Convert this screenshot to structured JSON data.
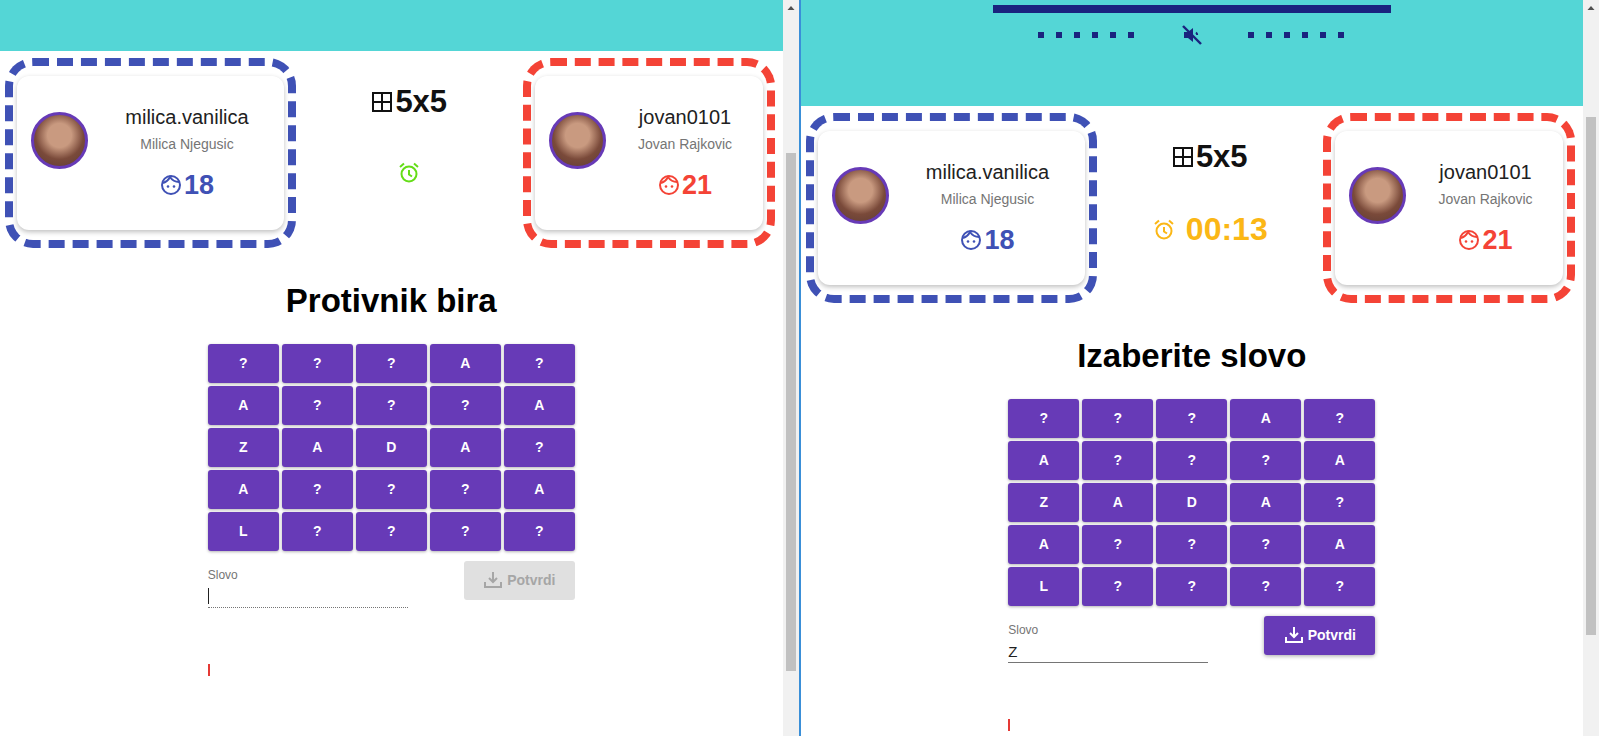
{
  "windows": [
    {
      "header": {
        "kind": "plain"
      },
      "players": [
        {
          "username": "milica.vanilica",
          "full_name": "Milica Njegusic",
          "score": "18",
          "color": "#3f51b5"
        },
        {
          "username": "jovan0101",
          "full_name": "Jovan Rajkovic",
          "score": "21",
          "color": "#f44336"
        }
      ],
      "board_size": "5x5",
      "timer": {
        "text": "",
        "color": "#64dd17"
      },
      "status": "Protivnik bira",
      "grid": [
        [
          "?",
          "?",
          "?",
          "A",
          "?"
        ],
        [
          "A",
          "?",
          "?",
          "?",
          "A"
        ],
        [
          "Z",
          "A",
          "D",
          "A",
          "?"
        ],
        [
          "A",
          "?",
          "?",
          "?",
          "A"
        ],
        [
          "L",
          "?",
          "?",
          "?",
          "?"
        ]
      ],
      "input": {
        "label": "Slovo",
        "value": "",
        "disabled": true,
        "focused": true
      },
      "confirm_button": {
        "label": "Potvrdi",
        "disabled": true
      },
      "scrollbar": {
        "thumb_start": 0.19,
        "thumb_size": 0.72
      }
    },
    {
      "header": {
        "kind": "controls",
        "muted": true,
        "level": 1
      },
      "players": [
        {
          "username": "milica.vanilica",
          "full_name": "Milica Njegusic",
          "score": "18",
          "color": "#3f51b5"
        },
        {
          "username": "jovan0101",
          "full_name": "Jovan Rajkovic",
          "score": "21",
          "color": "#f44336"
        }
      ],
      "board_size": "5x5",
      "timer": {
        "text": "00:13",
        "color": "#fbb716"
      },
      "status": "Izaberite slovo",
      "grid": [
        [
          "?",
          "?",
          "?",
          "A",
          "?"
        ],
        [
          "A",
          "?",
          "?",
          "?",
          "A"
        ],
        [
          "Z",
          "A",
          "D",
          "A",
          "?"
        ],
        [
          "A",
          "?",
          "?",
          "?",
          "A"
        ],
        [
          "L",
          "?",
          "?",
          "?",
          "?"
        ]
      ],
      "input": {
        "label": "Slovo",
        "value": "Z",
        "disabled": false,
        "focused": false
      },
      "confirm_button": {
        "label": "Potvrdi",
        "disabled": false
      },
      "scrollbar": {
        "thumb_start": 0.14,
        "thumb_size": 0.72
      }
    }
  ]
}
